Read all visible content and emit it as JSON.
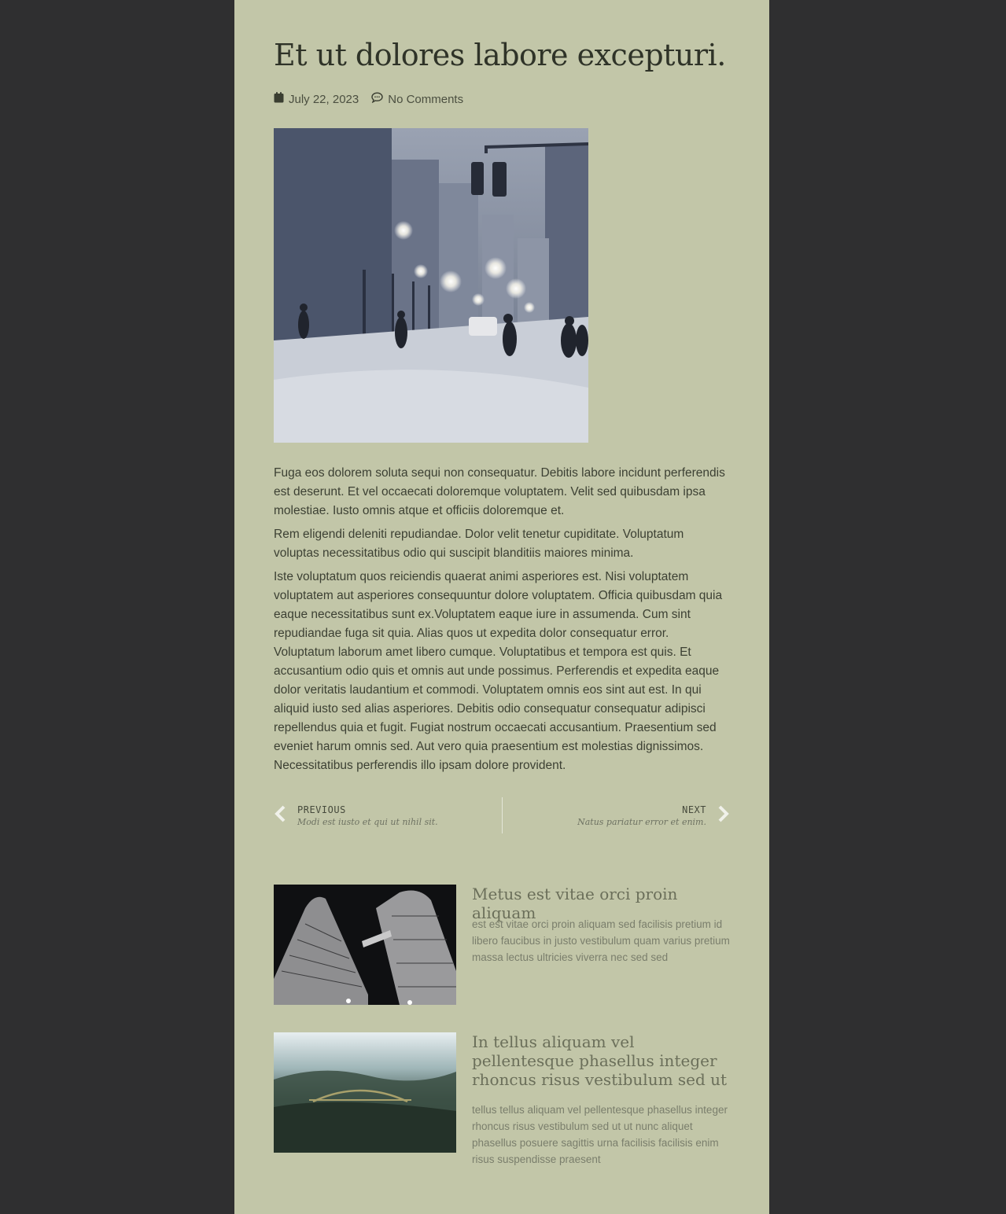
{
  "post": {
    "title": "Et ut dolores labore excepturi.",
    "date": "July 22, 2023",
    "comments": "No Comments",
    "paragraphs": [
      "Fuga eos dolorem soluta sequi non consequatur. Debitis labore incidunt perferendis est deserunt. Et vel occaecati doloremque voluptatem. Velit sed quibusdam ipsa molestiae. Iusto omnis atque et officiis doloremque et.",
      "Rem eligendi deleniti repudiandae. Dolor velit tenetur cupiditate. Voluptatum voluptas necessitatibus odio qui suscipit blanditiis maiores minima.",
      "Iste voluptatum quos reiciendis quaerat animi asperiores est. Nisi voluptatem voluptatem aut asperiores consequuntur dolore voluptatem. Officia quibusdam quia eaque necessitatibus sunt ex.Voluptatem eaque iure in assumenda. Cum sint repudiandae fuga sit quia. Alias quos ut expedita dolor consequatur error. Voluptatum laborum amet libero cumque. Voluptatibus et tempora est quis. Et accusantium odio quis et omnis aut unde possimus. Perferendis et expedita eaque dolor veritatis laudantium et commodi. Voluptatem omnis eos sint aut est. In qui aliquid iusto sed alias asperiores. Debitis odio consequatur consequatur adipisci repellendus quia et fugit. Fugiat nostrum occaecati accusantium. Praesentium sed eveniet harum omnis sed. Aut vero quia praesentium est molestias dignissimos. Necessitatibus perferendis illo ipsam dolore provident."
    ]
  },
  "postnav": {
    "prev_label": "Previous",
    "prev_title": "Modi est iusto et qui ut nihil sit.",
    "next_label": "Next",
    "next_title": "Natus pariatur error et enim."
  },
  "related": [
    {
      "title": "Metus est vitae orci proin aliquam",
      "excerpt": "est est vitae orci proin aliquam sed facilisis pretium id libero faucibus in justo vestibulum quam varius pretium massa lectus ultricies viverra nec sed sed"
    },
    {
      "title": "In tellus aliquam vel pellentesque phasellus integer rhoncus risus vestibulum sed ut",
      "excerpt": "tellus tellus aliquam vel pellentesque phasellus integer rhoncus risus vestibulum sed ut ut nunc aliquet phasellus posuere sagittis urna facilisis facilisis enim risus suspendisse praesent"
    }
  ],
  "colors": {
    "page_bg": "#c2c6a8",
    "outer_bg": "#2f2f30",
    "title": "#2f3328",
    "related_title": "#6b6f5a"
  },
  "icons": {
    "date": "calendar-icon",
    "comments": "comment-bubble-icon",
    "prev": "chevron-left-icon",
    "next": "chevron-right-icon"
  }
}
